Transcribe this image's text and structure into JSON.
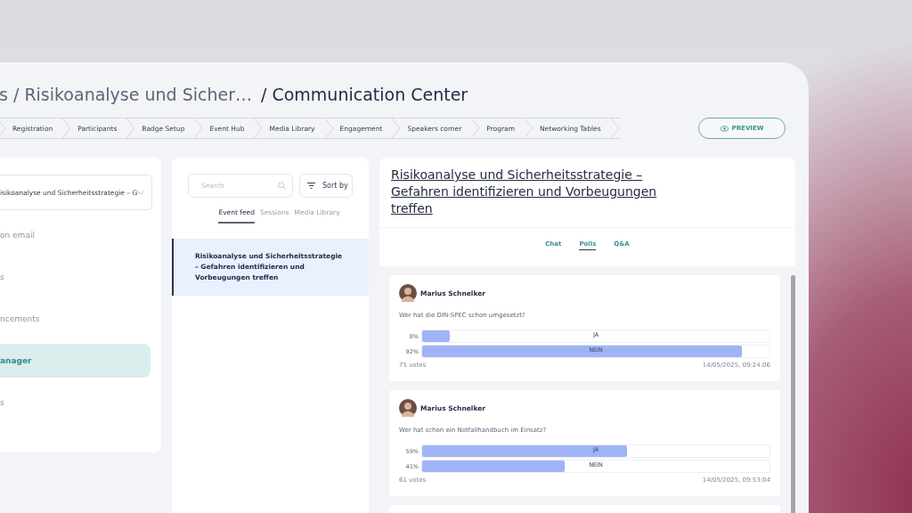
{
  "header": {
    "breadcrumb_path": "s / Risikoanalyse und Sicher…",
    "page_title": "/ Communication Center"
  },
  "steps": [
    {
      "label": "Registration"
    },
    {
      "label": "Participants"
    },
    {
      "label": "Badge Setup"
    },
    {
      "label": "Event Hub"
    },
    {
      "label": "Media Library"
    },
    {
      "label": "Engagement"
    },
    {
      "label": "Speakers corner"
    },
    {
      "label": "Program"
    },
    {
      "label": "Networking Tables"
    }
  ],
  "preview_button": {
    "label": "PREVIEW"
  },
  "sidebar": {
    "session_select": {
      "value": "isikoanalyse und Sicherheitsstrategie – G"
    },
    "items": [
      {
        "label": "on email",
        "selected": false
      },
      {
        "label": "s",
        "selected": false
      },
      {
        "label": "ncements",
        "selected": false
      },
      {
        "label": "anager",
        "selected": true
      },
      {
        "label": "s",
        "selected": false
      }
    ]
  },
  "feed": {
    "search": {
      "placeholder": "Search"
    },
    "sort_button": {
      "label": "Sort by"
    },
    "tabs": [
      {
        "label": "Event feed",
        "selected": true
      },
      {
        "label": "Sessions",
        "selected": false
      },
      {
        "label": "Media Library",
        "selected": false
      }
    ],
    "items": [
      {
        "title": "Risikoanalyse und Sicherheitsstrategie – Gefahren identifizieren und Vorbeugungen treffen",
        "selected": true
      }
    ]
  },
  "session": {
    "title": "Risikoanalyse und Sicherheitsstrategie – Gefahren identifizieren und Vorbeugungen treffen",
    "tabs": [
      {
        "label": "Chat",
        "selected": false
      },
      {
        "label": "Polls",
        "selected": true
      },
      {
        "label": "Q&A",
        "selected": false
      }
    ],
    "polls": [
      {
        "author": "Marius Schnelker",
        "question": "Wer hat die DIN-SPEC schon umgesetzt?",
        "options": [
          {
            "percent": "8%",
            "label": "JA",
            "level": 0.08
          },
          {
            "percent": "92%",
            "label": "NEIN",
            "level": 0.92
          }
        ],
        "votes": "75 votes",
        "time": "14/05/2025, 09:24:06"
      },
      {
        "author": "Marius Schnelker",
        "question": "Wer hat schon ein Notfallhandbuch im Einsatz?",
        "options": [
          {
            "percent": "59%",
            "label": "JA",
            "level": 0.59
          },
          {
            "percent": "41%",
            "label": "NEIN",
            "level": 0.41
          }
        ],
        "votes": "61 votes",
        "time": "14/05/2025, 09:53:04"
      }
    ]
  }
}
